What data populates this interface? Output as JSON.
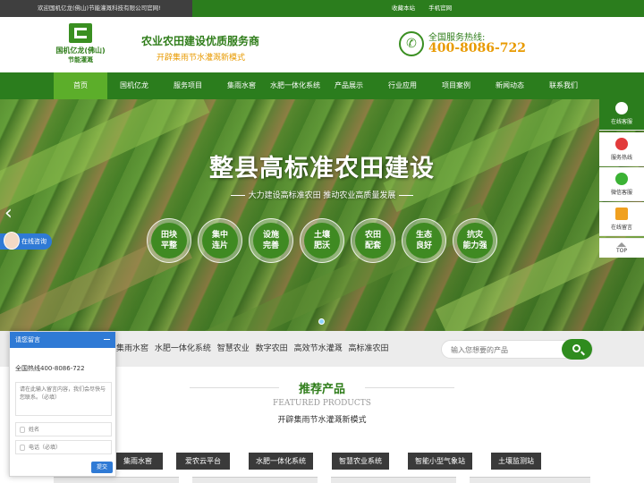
{
  "topbar": {
    "welcome": "欢迎国机亿龙(佛山)节能灌溉科技有限公司官网!",
    "links": [
      "收藏本站",
      "手机官网"
    ]
  },
  "logo": {
    "line1": "国机亿龙(佛山)",
    "line2": "节能灌溉"
  },
  "slogan": {
    "main": "农业农田建设优质服务商",
    "sub": "开辟集雨节水灌溉新模式"
  },
  "hotline": {
    "label": "全国服务热线:",
    "number": "400-8086-722"
  },
  "nav": [
    {
      "label": "首页",
      "active": true
    },
    {
      "label": "国机亿龙"
    },
    {
      "label": "服务项目"
    },
    {
      "label": "集雨水窖"
    },
    {
      "label": "水肥一体化系统"
    },
    {
      "label": "产品展示"
    },
    {
      "label": "行业应用"
    },
    {
      "label": "项目案例"
    },
    {
      "label": "新闻动态"
    },
    {
      "label": "联系我们"
    }
  ],
  "banner": {
    "title": "整县高标准农田建设",
    "subtitle": "大力建设高标准农田 推动农业高质量发展",
    "features": [
      {
        "line1": "田块",
        "line2": "平整"
      },
      {
        "line1": "集中",
        "line2": "连片"
      },
      {
        "line1": "设施",
        "line2": "完善"
      },
      {
        "line1": "土壤",
        "line2": "肥沃"
      },
      {
        "line1": "农田",
        "line2": "配套"
      },
      {
        "line1": "生态",
        "line2": "良好"
      },
      {
        "line1": "抗灾",
        "line2": "能力强"
      }
    ],
    "chat_badge": "在线咨询"
  },
  "sidebar": {
    "items": [
      {
        "label": "在线客服",
        "icon": "chat-icon"
      },
      {
        "label": "服务热线",
        "icon": "phone-icon"
      },
      {
        "label": "微信客服",
        "icon": "wechat-icon"
      },
      {
        "label": "在线留言",
        "icon": "message-icon"
      }
    ],
    "top_label": "TOP"
  },
  "hotwords": [
    "集雨水窖",
    "水肥一体化系统",
    "智慧农业",
    "数字农田",
    "高效节水灌溉",
    "高标准农田"
  ],
  "search": {
    "placeholder": "输入您想要的产品"
  },
  "recommend": {
    "title": "推荐产品",
    "en": "FEATURED PRODUCTS",
    "sub": "开辟集雨节水灌溉新模式"
  },
  "tabs": [
    "集雨水窖",
    "爱农云平台",
    "水肥一体化系统",
    "智慧农业系统",
    "智能小型气象站",
    "土壤监测站"
  ],
  "popup": {
    "title": "请您留言",
    "hotline": "全国热线400-8086-722",
    "textarea_placeholder": "请在此输入留言内容，我们会尽快与您联系。（必填）",
    "name_placeholder": "姓名",
    "phone_placeholder": "电话（必填）",
    "submit": "提交"
  },
  "colors": {
    "brand_green": "#2b7d1d",
    "accent_orange": "#e89a00",
    "popup_blue": "#2f7ad5"
  }
}
